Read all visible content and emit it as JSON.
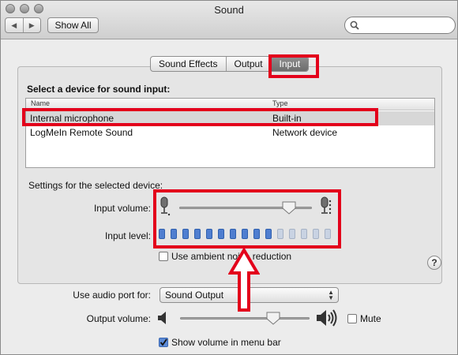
{
  "window": {
    "title": "Sound"
  },
  "toolbar": {
    "back_label": "◀",
    "forward_label": "▶",
    "show_all_label": "Show All",
    "search_value": "",
    "search_placeholder": ""
  },
  "tabs": [
    {
      "label": "Sound Effects",
      "selected": false
    },
    {
      "label": "Output",
      "selected": false
    },
    {
      "label": "Input",
      "selected": true
    }
  ],
  "input_section": {
    "device_heading": "Select a device for sound input:",
    "columns": [
      "Name",
      "Type"
    ],
    "devices": [
      {
        "name": "Internal microphone",
        "type": "Built-in",
        "selected": true
      },
      {
        "name": "LogMeIn Remote Sound",
        "type": "Network device",
        "selected": false
      }
    ],
    "settings_heading": "Settings for the selected device:",
    "input_volume_label": "Input volume:",
    "input_volume_fraction": 0.83,
    "input_level_label": "Input level:",
    "input_level_segments_total": 15,
    "input_level_segments_lit": 10,
    "ambient_label": "Use ambient noise reduction",
    "ambient_checked": false,
    "help_label": "?"
  },
  "output_section": {
    "audio_port_label": "Use audio port for:",
    "audio_port_value": "Sound Output",
    "output_volume_label": "Output volume:",
    "output_volume_fraction": 0.72,
    "mute_label": "Mute",
    "mute_checked": false,
    "show_volume_label": "Show volume in menu bar",
    "show_volume_checked": true
  },
  "colors": {
    "highlight": "#e3001b",
    "level_on": "#4f7ed0",
    "level_off": "#c9d3e3"
  }
}
